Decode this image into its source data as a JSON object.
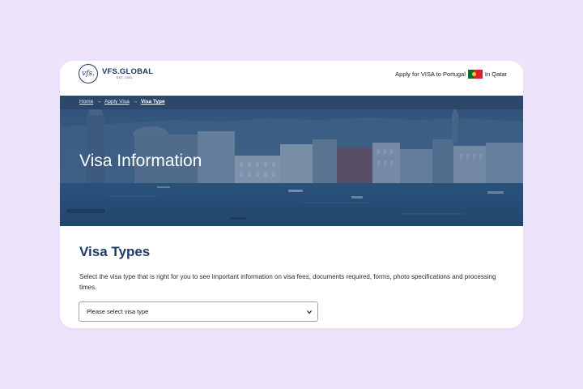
{
  "header": {
    "logo_mark": "vfs.",
    "logo_name": "VFS.GLOBAL",
    "logo_established": "EST. 2001",
    "apply_text": "Apply for VISA to Portugal",
    "country_text": "In Qatar"
  },
  "breadcrumb": {
    "home": "Home",
    "apply_visa": "Apply Visa",
    "current": "Visa Type",
    "separator": "→"
  },
  "hero": {
    "title": "Visa Information"
  },
  "main": {
    "section_title": "Visa Types",
    "description": "Select the visa type that is right for you to see important information on visa fees, documents required, forms, photo specifications and processing times.",
    "select": {
      "value": "Please select visa type"
    }
  },
  "colors": {
    "background": "#ede4fb",
    "brand_navy": "#1e3a66",
    "hero_overlay": "#2d4d70"
  }
}
